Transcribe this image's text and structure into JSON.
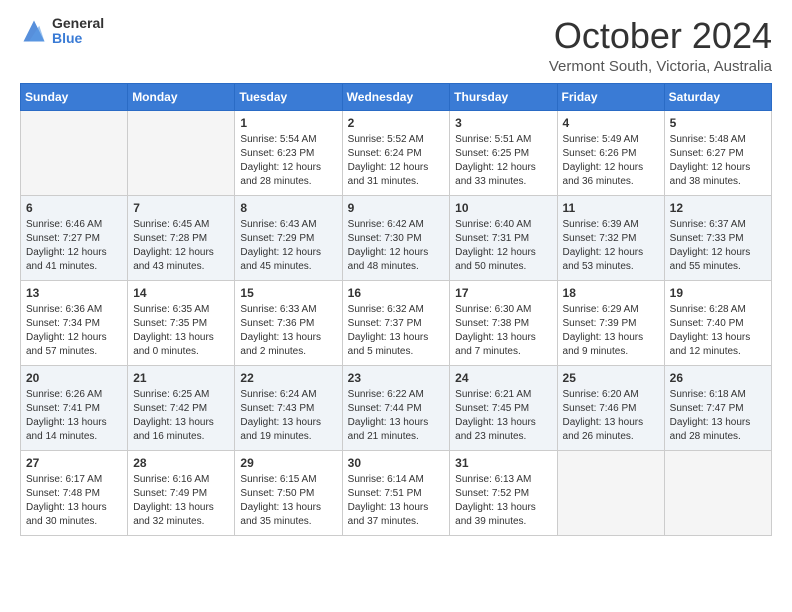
{
  "logo": {
    "general": "General",
    "blue": "Blue"
  },
  "title": "October 2024",
  "subtitle": "Vermont South, Victoria, Australia",
  "days": [
    "Sunday",
    "Monday",
    "Tuesday",
    "Wednesday",
    "Thursday",
    "Friday",
    "Saturday"
  ],
  "weeks": [
    [
      {
        "day": "",
        "empty": true
      },
      {
        "day": "",
        "empty": true
      },
      {
        "day": "1",
        "line1": "Sunrise: 5:54 AM",
        "line2": "Sunset: 6:23 PM",
        "line3": "Daylight: 12 hours",
        "line4": "and 28 minutes."
      },
      {
        "day": "2",
        "line1": "Sunrise: 5:52 AM",
        "line2": "Sunset: 6:24 PM",
        "line3": "Daylight: 12 hours",
        "line4": "and 31 minutes."
      },
      {
        "day": "3",
        "line1": "Sunrise: 5:51 AM",
        "line2": "Sunset: 6:25 PM",
        "line3": "Daylight: 12 hours",
        "line4": "and 33 minutes."
      },
      {
        "day": "4",
        "line1": "Sunrise: 5:49 AM",
        "line2": "Sunset: 6:26 PM",
        "line3": "Daylight: 12 hours",
        "line4": "and 36 minutes."
      },
      {
        "day": "5",
        "line1": "Sunrise: 5:48 AM",
        "line2": "Sunset: 6:27 PM",
        "line3": "Daylight: 12 hours",
        "line4": "and 38 minutes."
      }
    ],
    [
      {
        "day": "6",
        "line1": "Sunrise: 6:46 AM",
        "line2": "Sunset: 7:27 PM",
        "line3": "Daylight: 12 hours",
        "line4": "and 41 minutes."
      },
      {
        "day": "7",
        "line1": "Sunrise: 6:45 AM",
        "line2": "Sunset: 7:28 PM",
        "line3": "Daylight: 12 hours",
        "line4": "and 43 minutes."
      },
      {
        "day": "8",
        "line1": "Sunrise: 6:43 AM",
        "line2": "Sunset: 7:29 PM",
        "line3": "Daylight: 12 hours",
        "line4": "and 45 minutes."
      },
      {
        "day": "9",
        "line1": "Sunrise: 6:42 AM",
        "line2": "Sunset: 7:30 PM",
        "line3": "Daylight: 12 hours",
        "line4": "and 48 minutes."
      },
      {
        "day": "10",
        "line1": "Sunrise: 6:40 AM",
        "line2": "Sunset: 7:31 PM",
        "line3": "Daylight: 12 hours",
        "line4": "and 50 minutes."
      },
      {
        "day": "11",
        "line1": "Sunrise: 6:39 AM",
        "line2": "Sunset: 7:32 PM",
        "line3": "Daylight: 12 hours",
        "line4": "and 53 minutes."
      },
      {
        "day": "12",
        "line1": "Sunrise: 6:37 AM",
        "line2": "Sunset: 7:33 PM",
        "line3": "Daylight: 12 hours",
        "line4": "and 55 minutes."
      }
    ],
    [
      {
        "day": "13",
        "line1": "Sunrise: 6:36 AM",
        "line2": "Sunset: 7:34 PM",
        "line3": "Daylight: 12 hours",
        "line4": "and 57 minutes."
      },
      {
        "day": "14",
        "line1": "Sunrise: 6:35 AM",
        "line2": "Sunset: 7:35 PM",
        "line3": "Daylight: 13 hours",
        "line4": "and 0 minutes."
      },
      {
        "day": "15",
        "line1": "Sunrise: 6:33 AM",
        "line2": "Sunset: 7:36 PM",
        "line3": "Daylight: 13 hours",
        "line4": "and 2 minutes."
      },
      {
        "day": "16",
        "line1": "Sunrise: 6:32 AM",
        "line2": "Sunset: 7:37 PM",
        "line3": "Daylight: 13 hours",
        "line4": "and 5 minutes."
      },
      {
        "day": "17",
        "line1": "Sunrise: 6:30 AM",
        "line2": "Sunset: 7:38 PM",
        "line3": "Daylight: 13 hours",
        "line4": "and 7 minutes."
      },
      {
        "day": "18",
        "line1": "Sunrise: 6:29 AM",
        "line2": "Sunset: 7:39 PM",
        "line3": "Daylight: 13 hours",
        "line4": "and 9 minutes."
      },
      {
        "day": "19",
        "line1": "Sunrise: 6:28 AM",
        "line2": "Sunset: 7:40 PM",
        "line3": "Daylight: 13 hours",
        "line4": "and 12 minutes."
      }
    ],
    [
      {
        "day": "20",
        "line1": "Sunrise: 6:26 AM",
        "line2": "Sunset: 7:41 PM",
        "line3": "Daylight: 13 hours",
        "line4": "and 14 minutes."
      },
      {
        "day": "21",
        "line1": "Sunrise: 6:25 AM",
        "line2": "Sunset: 7:42 PM",
        "line3": "Daylight: 13 hours",
        "line4": "and 16 minutes."
      },
      {
        "day": "22",
        "line1": "Sunrise: 6:24 AM",
        "line2": "Sunset: 7:43 PM",
        "line3": "Daylight: 13 hours",
        "line4": "and 19 minutes."
      },
      {
        "day": "23",
        "line1": "Sunrise: 6:22 AM",
        "line2": "Sunset: 7:44 PM",
        "line3": "Daylight: 13 hours",
        "line4": "and 21 minutes."
      },
      {
        "day": "24",
        "line1": "Sunrise: 6:21 AM",
        "line2": "Sunset: 7:45 PM",
        "line3": "Daylight: 13 hours",
        "line4": "and 23 minutes."
      },
      {
        "day": "25",
        "line1": "Sunrise: 6:20 AM",
        "line2": "Sunset: 7:46 PM",
        "line3": "Daylight: 13 hours",
        "line4": "and 26 minutes."
      },
      {
        "day": "26",
        "line1": "Sunrise: 6:18 AM",
        "line2": "Sunset: 7:47 PM",
        "line3": "Daylight: 13 hours",
        "line4": "and 28 minutes."
      }
    ],
    [
      {
        "day": "27",
        "line1": "Sunrise: 6:17 AM",
        "line2": "Sunset: 7:48 PM",
        "line3": "Daylight: 13 hours",
        "line4": "and 30 minutes."
      },
      {
        "day": "28",
        "line1": "Sunrise: 6:16 AM",
        "line2": "Sunset: 7:49 PM",
        "line3": "Daylight: 13 hours",
        "line4": "and 32 minutes."
      },
      {
        "day": "29",
        "line1": "Sunrise: 6:15 AM",
        "line2": "Sunset: 7:50 PM",
        "line3": "Daylight: 13 hours",
        "line4": "and 35 minutes."
      },
      {
        "day": "30",
        "line1": "Sunrise: 6:14 AM",
        "line2": "Sunset: 7:51 PM",
        "line3": "Daylight: 13 hours",
        "line4": "and 37 minutes."
      },
      {
        "day": "31",
        "line1": "Sunrise: 6:13 AM",
        "line2": "Sunset: 7:52 PM",
        "line3": "Daylight: 13 hours",
        "line4": "and 39 minutes."
      },
      {
        "day": "",
        "empty": true
      },
      {
        "day": "",
        "empty": true
      }
    ]
  ]
}
